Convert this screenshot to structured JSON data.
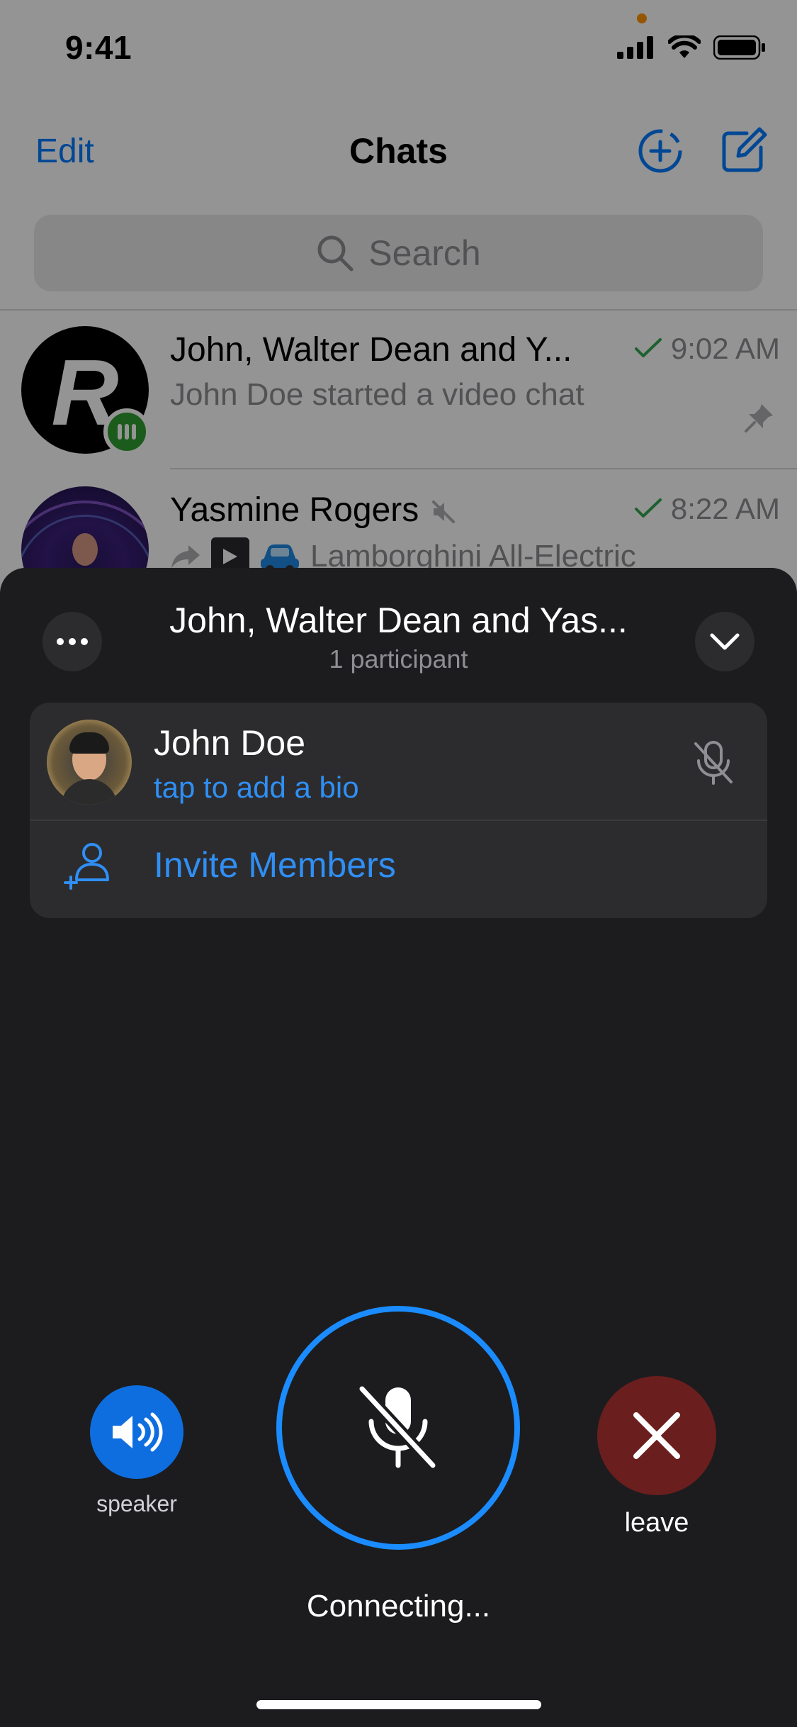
{
  "status_bar": {
    "time": "9:41"
  },
  "nav": {
    "edit_label": "Edit",
    "title": "Chats"
  },
  "search": {
    "placeholder": "Search"
  },
  "chats": [
    {
      "name": "John, Walter Dean and Y...",
      "preview": "John Doe started a video chat",
      "time": "9:02 AM",
      "avatar_letter": "R"
    },
    {
      "name": "Yasmine Rogers",
      "preview": "Lamborghini All-Electric",
      "time": "8:22 AM"
    }
  ],
  "voice_chat": {
    "title": "John, Walter Dean and Yas...",
    "subtitle": "1 participant",
    "participant": {
      "name": "John Doe",
      "bio_hint": "tap to add a bio"
    },
    "invite_label": "Invite Members",
    "speaker_label": "speaker",
    "leave_label": "leave",
    "status": "Connecting..."
  },
  "colors": {
    "accent": "#007aff",
    "sheet_bg": "#1c1c1e",
    "card_bg": "#2c2c2e",
    "mic_ring": "#1a8cff",
    "speaker_bg": "#0e6ee0",
    "leave_bg": "#6b1e1e",
    "online_badge": "#2f9e2f",
    "check": "#34a853"
  }
}
